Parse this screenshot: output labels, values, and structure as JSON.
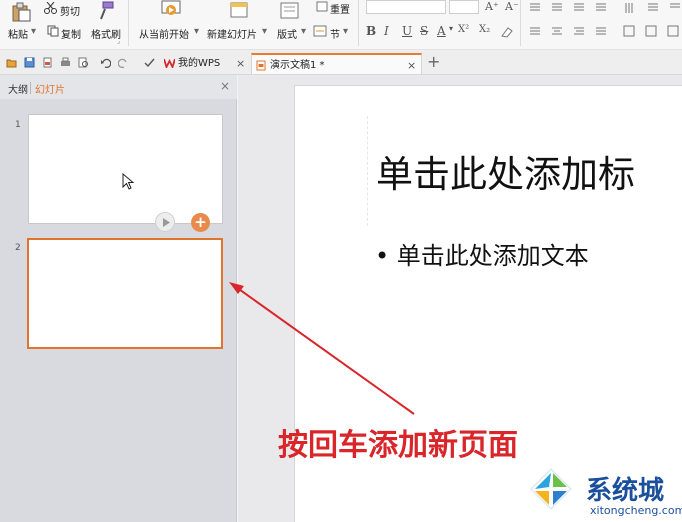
{
  "ribbon": {
    "paste": "粘贴",
    "cut": "剪切",
    "copy": "复制",
    "format_painter": "格式刷",
    "from_current": "从当前开始",
    "new_slide": "新建幻灯片",
    "layout": "版式",
    "section": "节",
    "reset": "重置",
    "bold": "B",
    "italic": "I",
    "underline": "U",
    "strike": "S",
    "font_color": "A",
    "superscript": "X²",
    "subscript": "X₂",
    "grow_font": "A⁺",
    "shrink_font": "A⁻"
  },
  "tabs": [
    {
      "label": "我的WPS",
      "close": "×"
    },
    {
      "label": "演示文稿1 *",
      "close": "×"
    }
  ],
  "tab_plus": "+",
  "pane": {
    "tab_outline": "大纲",
    "tab_slides": "幻灯片",
    "close": "×",
    "slide_numbers": [
      "1",
      "2"
    ],
    "add_symbol": "+"
  },
  "slide": {
    "title": "单击此处添加标",
    "bullet": "• 单击此处添加文本"
  },
  "annotation": "按回车添加新页面",
  "watermark": {
    "name": "系统城",
    "url": "xitongcheng.com"
  },
  "colors": {
    "accent": "#e0742a",
    "annotation": "#d9262a",
    "watermark": "#1a4f9c"
  }
}
